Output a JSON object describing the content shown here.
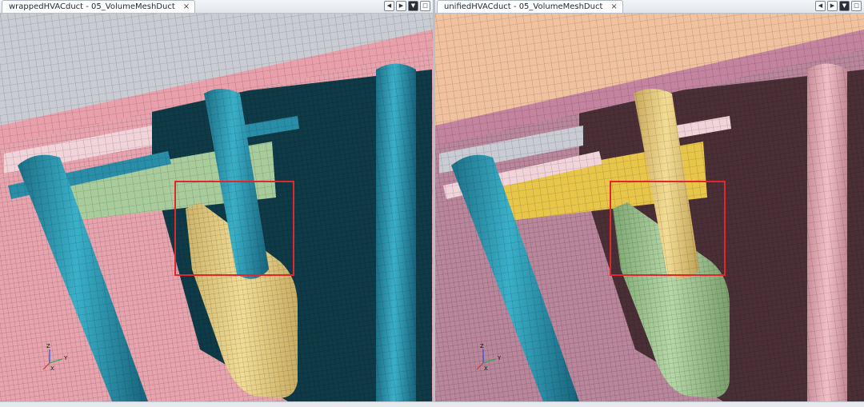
{
  "left_pane": {
    "tab_title": "wrappedHVACduct - 05_VolumeMeshDuct",
    "close_glyph": "×",
    "controls": [
      "◀",
      "▶",
      "▼",
      "□"
    ]
  },
  "right_pane": {
    "tab_title": "unifiedHVACduct - 05_VolumeMeshDuct",
    "close_glyph": "×",
    "controls": [
      "◀",
      "▶",
      "▼",
      "□"
    ]
  },
  "axis_labels": {
    "z": "Z",
    "y": "Y",
    "x": "X"
  },
  "colors": {
    "pink": "#e8a4ae",
    "blue": "#2a8ea8",
    "teal_dark": "#0f3a47",
    "yellow": "#e6cf86",
    "green": "#a9cc9c",
    "gray": "#c9ccd3",
    "orange": "#f1c29f",
    "mauve": "#b9869c",
    "gold": "#e8c64a",
    "highlight": "#e3262b"
  }
}
